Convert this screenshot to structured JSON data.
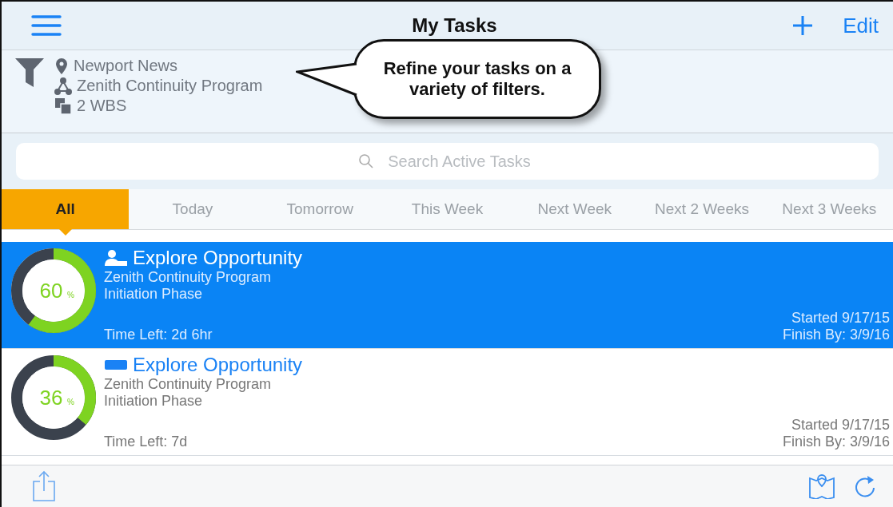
{
  "nav": {
    "title": "My Tasks",
    "edit": "Edit"
  },
  "filters": [
    {
      "kind": "location",
      "label": "Newport News"
    },
    {
      "kind": "program",
      "label": "Zenith Continuity Program"
    },
    {
      "kind": "wbs",
      "label": "2 WBS"
    }
  ],
  "callout": "Refine your tasks on a variety of filters.",
  "search": {
    "placeholder": "Search Active Tasks"
  },
  "tabs": [
    {
      "label": "All",
      "selected": true
    },
    {
      "label": "Today",
      "selected": false
    },
    {
      "label": "Tomorrow",
      "selected": false
    },
    {
      "label": "This Week",
      "selected": false
    },
    {
      "label": "Next Week",
      "selected": false
    },
    {
      "label": "Next 2 Weeks",
      "selected": false
    },
    {
      "label": "Next 3 Weeks",
      "selected": false
    }
  ],
  "tasks": [
    {
      "kind": "person",
      "selected": true,
      "level": 0.6,
      "percent": "60",
      "unit": "%",
      "title": "Explore Opportunity",
      "program": "Zenith Continuity Program",
      "phase": "Initiation Phase",
      "time_left": "Time Left: 2d 6hr",
      "started": "Started 9/17/15",
      "finish": "Finish By: 3/9/16"
    },
    {
      "kind": "bar",
      "selected": false,
      "level": 0.36,
      "percent": "36",
      "unit": "%",
      "title": "Explore Opportunity",
      "program": "Zenith Continuity Program",
      "phase": "Initiation Phase",
      "time_left": "Time Left: 7d",
      "started": "Started 9/17/15",
      "finish": "Finish By: 3/9/16"
    }
  ]
}
